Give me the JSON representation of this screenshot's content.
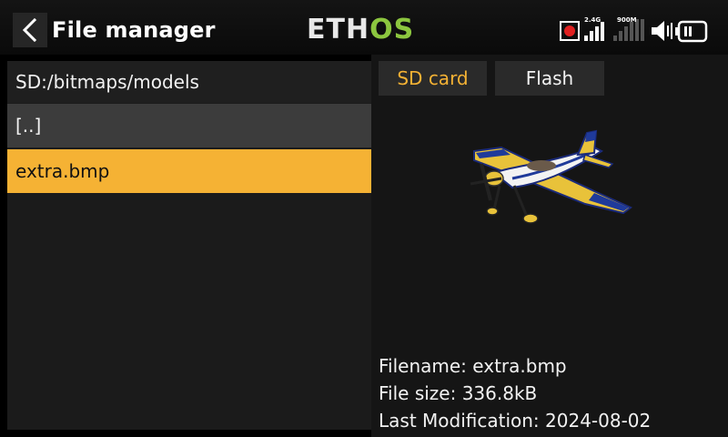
{
  "header": {
    "title": "File manager",
    "logo": {
      "part1": "ETH",
      "part2": "OS"
    },
    "status": {
      "rf1_label": "2.4G",
      "rf2_label": "900M"
    }
  },
  "browser": {
    "path": "SD:/bitmaps/models",
    "items": [
      {
        "label": "[..]"
      },
      {
        "label": "extra.bmp"
      }
    ]
  },
  "tabs": [
    {
      "label": "SD card"
    },
    {
      "label": "Flash"
    }
  ],
  "details": {
    "filename_label": "Filename: extra.bmp",
    "filesize_label": "File size: 336.8kB",
    "modified_label": "Last Modification: 2024-08-02"
  },
  "colors": {
    "accent": "#f5b234",
    "logo_green": "#8cc63f",
    "record_red": "#e02020"
  },
  "icons": [
    "back-icon",
    "record-icon",
    "signal-icon",
    "speaker-icon",
    "battery-icon",
    "airplane-preview"
  ]
}
